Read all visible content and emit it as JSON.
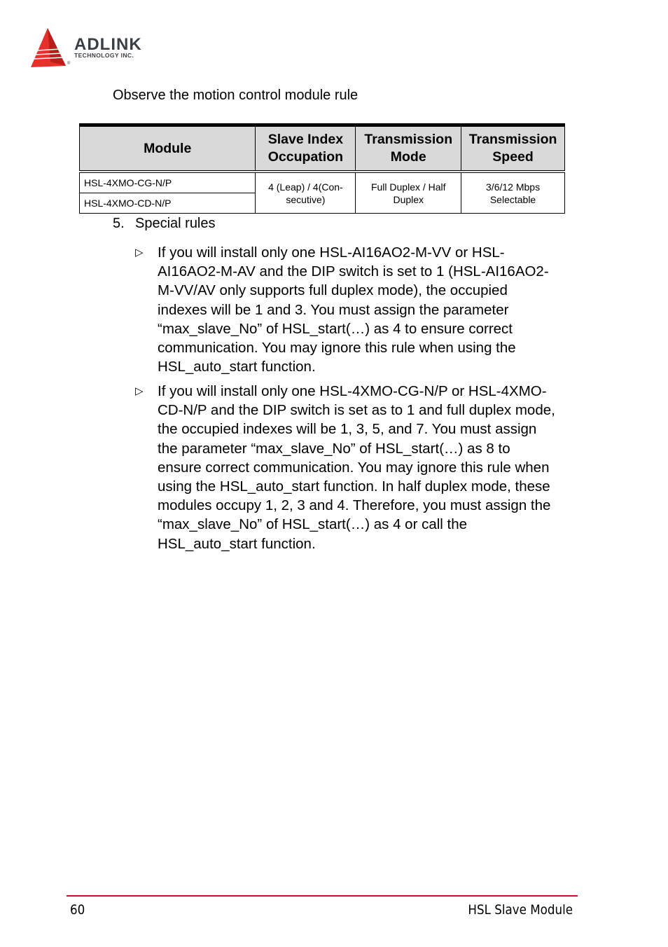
{
  "header": {
    "logo": {
      "brand": "ADLINK",
      "subtitle": "TECHNOLOGY INC.",
      "registered": "®",
      "colors": {
        "triangle": "#e8302a",
        "text": "#3a3f44"
      }
    }
  },
  "intro": "Observe the motion control module rule",
  "table": {
    "columns": [
      "Module",
      "Slave Index Occupation",
      "Transmission Mode",
      "Transmission Speed"
    ],
    "header_bg": "#d9d9d9",
    "rows": [
      {
        "module": "HSL-4XMO-CG-N/P"
      },
      {
        "module": "HSL-4XMO-CD-N/P"
      }
    ],
    "shared": {
      "slave_index_occupation": "4 (Leap) / 4(Con-secutive)",
      "transmission_mode": "Full Duplex / Half Duplex",
      "transmission_speed": "3/6/12 Mbps Selectable"
    }
  },
  "section": {
    "number": "5.",
    "title": "Special rules",
    "bullets": [
      {
        "icon": "triangle-right-outline-icon",
        "glyph": "▷",
        "text": "If you will install only one HSL-AI16AO2-M-VV or HSL-AI16AO2-M-AV and the DIP switch is set to 1 (HSL-AI16AO2-M-VV/AV only supports full duplex mode), the occupied indexes will be 1 and 3. You must assign the parameter “max_slave_No” of HSL_start(…) as 4 to ensure correct communication. You may ignore this rule when using the HSL_auto_start function."
      },
      {
        "icon": "triangle-right-outline-icon",
        "glyph": "▷",
        "text": "If you will install only one HSL-4XMO-CG-N/P or HSL-4XMO-CD-N/P and the DIP switch is set as to 1 and full duplex mode, the occupied indexes will be 1, 3, 5, and 7. You must assign the parameter “max_slave_No” of HSL_start(…) as 8 to ensure correct communication. You may ignore this rule when using the HSL_auto_start function. In half duplex mode, these modules occupy 1, 2, 3 and 4. Therefore, you must assign the “max_slave_No” of HSL_start(…) as 4 or call the HSL_auto_start function."
      }
    ]
  },
  "footer": {
    "page_number": "60",
    "chapter_title": "HSL Slave Module",
    "rule_color": "#c8102e"
  }
}
